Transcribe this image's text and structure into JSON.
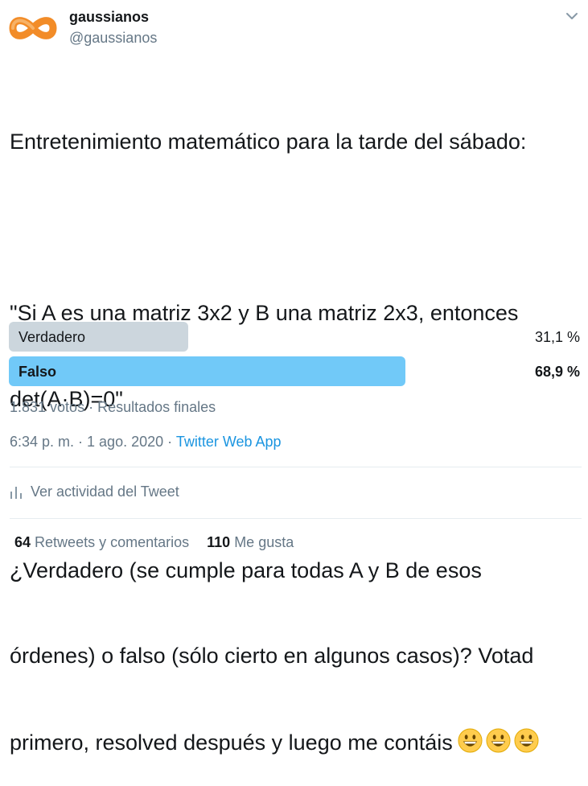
{
  "author": {
    "display_name": "gaussianos",
    "handle": "@gaussianos",
    "avatar_icon": "infinity-logo-icon",
    "avatar_color": "#f28c28"
  },
  "tweet": {
    "lines": [
      "Entretenimiento matemático para la tarde del sábado:",
      "",
      "\"Si A es una matriz 3x2 y B una matriz 2x3, entonces",
      "det(A·B)=0\"",
      "",
      "¿Verdadero (se cumple para todas A y B de esos",
      "órdenes) o falso (sólo cierto en algunos casos)? Votad",
      "primero, resolved después y luego me contáis"
    ],
    "emoji": [
      "grinning-face-icon",
      "grinning-face-icon",
      "grinning-face-icon"
    ]
  },
  "poll": {
    "options": [
      {
        "label": "Verdadero",
        "percent_text": "31,1 %",
        "fraction": 0.311,
        "color": "#ccd6dd",
        "winner": false
      },
      {
        "label": "Falso",
        "percent_text": "68,9 %",
        "fraction": 0.689,
        "color": "#71c9f8",
        "winner": true
      }
    ],
    "meta": "1.831 votos · Resultados finales"
  },
  "timestamp": {
    "time": "6:34 p. m. · 1 ago. 2020 · ",
    "app": "Twitter Web App"
  },
  "activity": {
    "label": "Ver actividad del Tweet",
    "icon": "bar-chart-icon"
  },
  "stats": {
    "retweets_count": "64",
    "retweets_label": "Retweets y comentarios",
    "likes_count": "110",
    "likes_label": "Me gusta"
  },
  "colors": {
    "accent": "#1b95e0",
    "secondary_text": "#657786",
    "primary_text": "#14171a"
  }
}
